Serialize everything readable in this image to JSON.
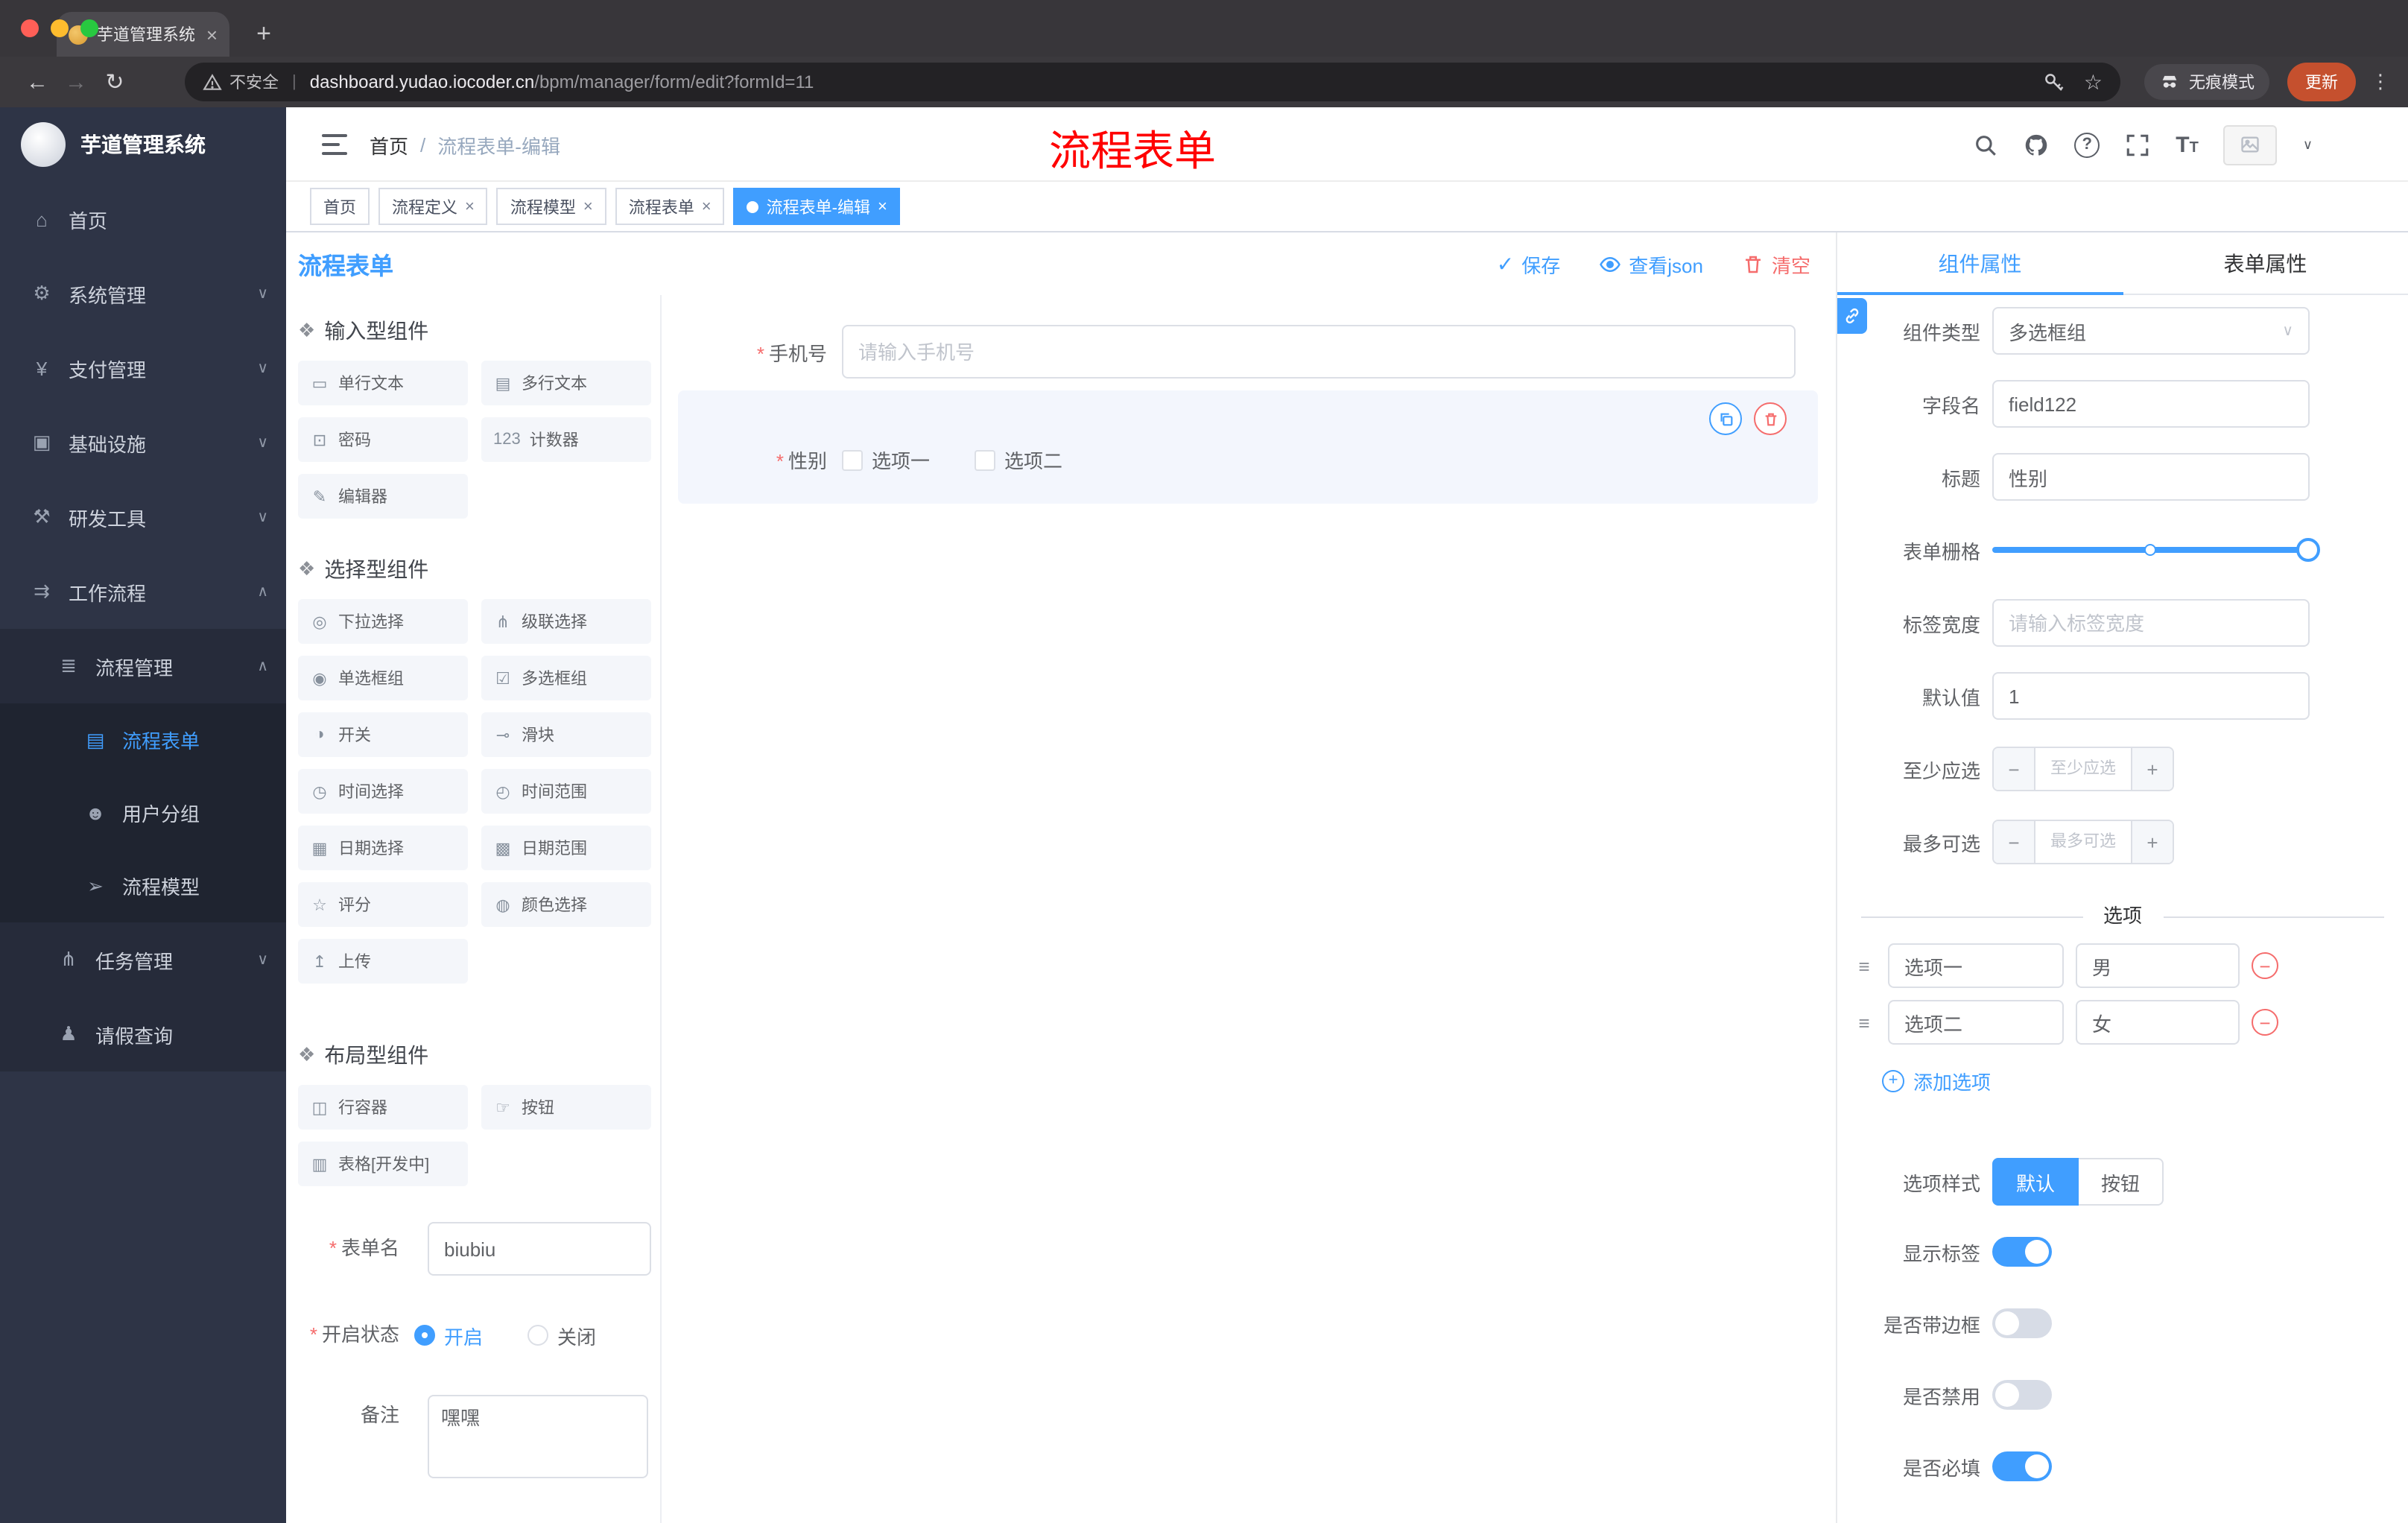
{
  "browser": {
    "tab_title": "芋道管理系统",
    "security": "不安全",
    "domain": "dashboard.yudao.iocoder.cn",
    "path": "/bpm/manager/form/edit?formId=11",
    "incognito": "无痕模式",
    "update": "更新"
  },
  "icons": {
    "close": "×",
    "new_tab": "+",
    "back": "←",
    "forward": "→",
    "reload": "↻",
    "pipe": "|",
    "star": "☆",
    "kebab": "⋮",
    "caret": "∨",
    "check": "✓",
    "required": "*",
    "drag": "❖",
    "row_drag": "≡",
    "minus": "−",
    "plus": "+",
    "help": "?",
    "font_big": "T",
    "font_small": "T",
    "select_caret": "∨"
  },
  "sidebar": {
    "title": "芋道管理系统",
    "items": [
      {
        "icon": "⌂",
        "label": "首页"
      },
      {
        "icon": "⚙",
        "label": "系统管理",
        "chev": "∨"
      },
      {
        "icon": "¥",
        "label": "支付管理",
        "chev": "∨"
      },
      {
        "icon": "▣",
        "label": "基础设施",
        "chev": "∨"
      },
      {
        "icon": "⚒",
        "label": "研发工具",
        "chev": "∨"
      },
      {
        "icon": "⇉",
        "label": "工作流程",
        "chev": "∧"
      },
      {
        "icon": "≣",
        "label": "流程管理",
        "chev": "∧"
      },
      {
        "icon": "▤",
        "label": "流程表单"
      },
      {
        "icon": "☻",
        "label": "用户分组"
      },
      {
        "icon": "➢",
        "label": "流程模型"
      },
      {
        "icon": "⋔",
        "label": "任务管理",
        "chev": "∨"
      },
      {
        "icon": "♟",
        "label": "请假查询"
      }
    ]
  },
  "header": {
    "crumb1": "首页",
    "sep": "/",
    "crumb2": "流程表单-编辑",
    "annotation": "流程表单"
  },
  "tags": [
    {
      "label": "首页"
    },
    {
      "label": "流程定义"
    },
    {
      "label": "流程模型"
    },
    {
      "label": "流程表单"
    },
    {
      "label": "流程表单-编辑"
    }
  ],
  "designer": {
    "title": "流程表单",
    "save": "保存",
    "view_json": "查看json",
    "clear": "清空"
  },
  "palette": {
    "groups": [
      {
        "title": "输入型组件",
        "items": [
          {
            "icon": "▭",
            "label": "单行文本"
          },
          {
            "icon": "▤",
            "label": "多行文本"
          },
          {
            "icon": "⊡",
            "label": "密码"
          },
          {
            "icon": "123",
            "label": "计数器"
          },
          {
            "icon": "✎",
            "label": "编辑器"
          }
        ]
      },
      {
        "title": "选择型组件",
        "items": [
          {
            "icon": "◎",
            "label": "下拉选择"
          },
          {
            "icon": "⋔",
            "label": "级联选择"
          },
          {
            "icon": "◉",
            "label": "单选框组"
          },
          {
            "icon": "☑",
            "label": "多选框组"
          },
          {
            "icon": "◑",
            "label": "开关"
          },
          {
            "icon": "⊸",
            "label": "滑块"
          },
          {
            "icon": "◷",
            "label": "时间选择"
          },
          {
            "icon": "◴",
            "label": "时间范围"
          },
          {
            "icon": "▦",
            "label": "日期选择"
          },
          {
            "icon": "▩",
            "label": "日期范围"
          },
          {
            "icon": "☆",
            "label": "评分"
          },
          {
            "icon": "◍",
            "label": "颜色选择"
          },
          {
            "icon": "↥",
            "label": "上传"
          }
        ]
      },
      {
        "title": "布局型组件",
        "items": [
          {
            "icon": "◫",
            "label": "行容器"
          },
          {
            "icon": "☞",
            "label": "按钮"
          },
          {
            "icon": "▥",
            "label": "表格[开发中]"
          }
        ]
      }
    ]
  },
  "meta": {
    "name_label": "表单名",
    "name_value": "biubiu",
    "status_label": "开启状态",
    "on_label": "开启",
    "off_label": "关闭",
    "remark_label": "备注",
    "remark_value": "嘿嘿"
  },
  "canvas": {
    "phone_label": "手机号",
    "phone_placeholder": "请输入手机号",
    "gender_label": "性别",
    "opt1": "选项一",
    "opt2": "选项二"
  },
  "props": {
    "tab_component": "组件属性",
    "tab_form": "表单属性",
    "type_label": "组件类型",
    "type_value": "多选框组",
    "field_label": "字段名",
    "field_value": "field122",
    "title_label": "标题",
    "title_value": "性别",
    "grid_label": "表单栅格",
    "width_label": "标签宽度",
    "width_placeholder": "请输入标签宽度",
    "default_label": "默认值",
    "default_value": "1",
    "min_label": "至少应选",
    "min_placeholder": "至少应选",
    "max_label": "最多可选",
    "max_placeholder": "最多可选",
    "divider": "选项",
    "options": [
      {
        "label": "选项一",
        "value": "男"
      },
      {
        "label": "选项二",
        "value": "女"
      }
    ],
    "add_option": "添加选项",
    "style_label": "选项样式",
    "style_default": "默认",
    "style_button": "按钮",
    "toggles": [
      {
        "label": "显示标签",
        "on": true
      },
      {
        "label": "是否带边框",
        "on": false
      },
      {
        "label": "是否禁用",
        "on": false
      },
      {
        "label": "是否必填",
        "on": true
      }
    ]
  },
  "colors": {
    "accent": "#409eff",
    "danger": "#f56c6c",
    "annotation": "#ff0000",
    "update_button": "#c5502e",
    "sidebar_bg": "#2e3446",
    "tag_active": "#409eff"
  }
}
